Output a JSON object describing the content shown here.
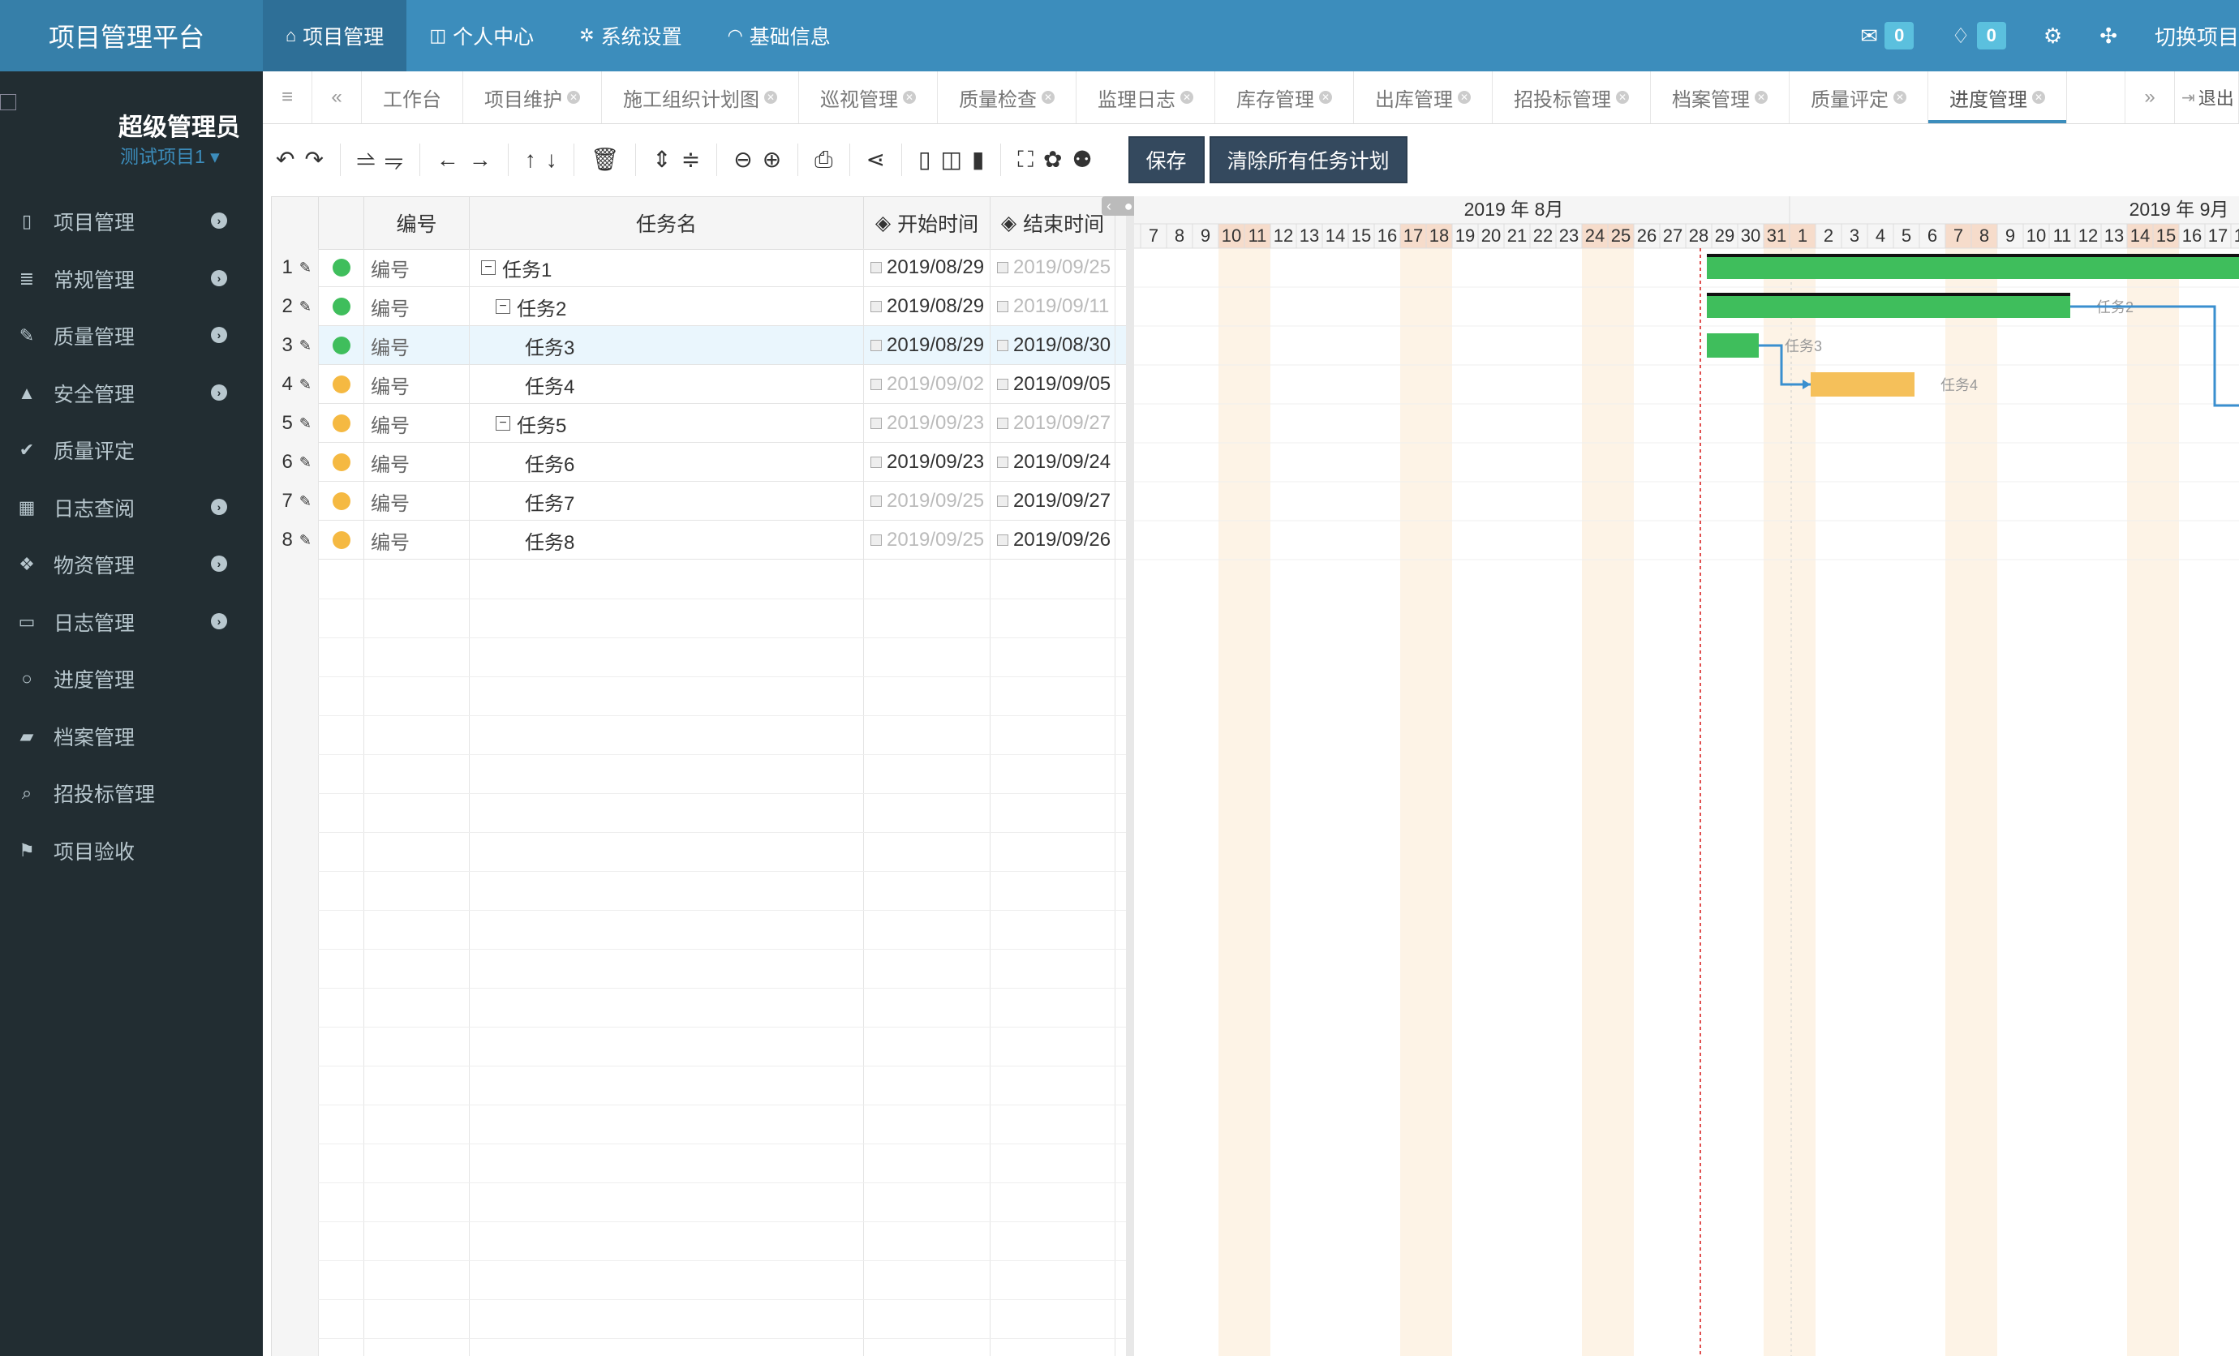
{
  "app_title": "项目管理平台",
  "topnav": [
    {
      "icon": "home-icon",
      "glyph": "⌂",
      "label": "项目管理",
      "active": true
    },
    {
      "icon": "columns-icon",
      "glyph": "◫",
      "label": "个人中心",
      "active": false
    },
    {
      "icon": "gear-icon",
      "glyph": "✲",
      "label": "系统设置",
      "active": false
    },
    {
      "icon": "headset-icon",
      "glyph": "◠",
      "label": "基础信息",
      "active": false
    }
  ],
  "topright": {
    "messages": "0",
    "notifications": "0",
    "switch_label": "切换项目"
  },
  "user": {
    "name": "超级管理员",
    "project": "测试项目1 ▾"
  },
  "sidebar": [
    {
      "icon": "book-icon",
      "glyph": "▯",
      "label": "项目管理",
      "arrow": true
    },
    {
      "icon": "list-icon",
      "glyph": "≣",
      "label": "常规管理",
      "arrow": true
    },
    {
      "icon": "edit-icon",
      "glyph": "✎",
      "label": "质量管理",
      "arrow": true
    },
    {
      "icon": "warning-icon",
      "glyph": "▲",
      "label": "安全管理",
      "arrow": true
    },
    {
      "icon": "check-circle-icon",
      "glyph": "✔",
      "label": "质量评定",
      "arrow": false
    },
    {
      "icon": "calendar-icon",
      "glyph": "▦",
      "label": "日志查阅",
      "arrow": true
    },
    {
      "icon": "cubes-icon",
      "glyph": "❖",
      "label": "物资管理",
      "arrow": true
    },
    {
      "icon": "card-icon",
      "glyph": "▭",
      "label": "日志管理",
      "arrow": true
    },
    {
      "icon": "circle-notch-icon",
      "glyph": "○",
      "label": "进度管理",
      "arrow": false
    },
    {
      "icon": "archive-icon",
      "glyph": "▰",
      "label": "档案管理",
      "arrow": false
    },
    {
      "icon": "search-icon",
      "glyph": "⌕",
      "label": "招投标管理",
      "arrow": false
    },
    {
      "icon": "flag-icon",
      "glyph": "⚑",
      "label": "项目验收",
      "arrow": false
    }
  ],
  "tabs": [
    {
      "label": "工作台",
      "closable": false,
      "active": false
    },
    {
      "label": "项目维护",
      "closable": true,
      "active": false
    },
    {
      "label": "施工组织计划图",
      "closable": true,
      "active": false
    },
    {
      "label": "巡视管理",
      "closable": true,
      "active": false
    },
    {
      "label": "质量检查",
      "closable": true,
      "active": false
    },
    {
      "label": "监理日志",
      "closable": true,
      "active": false
    },
    {
      "label": "库存管理",
      "closable": true,
      "active": false
    },
    {
      "label": "出库管理",
      "closable": true,
      "active": false
    },
    {
      "label": "招投标管理",
      "closable": true,
      "active": false
    },
    {
      "label": "档案管理",
      "closable": true,
      "active": false
    },
    {
      "label": "质量评定",
      "closable": true,
      "active": false
    },
    {
      "label": "进度管理",
      "closable": true,
      "active": true
    }
  ],
  "tabs_logout": "退出",
  "toolbar": {
    "save_label": "保存",
    "clear_label": "清除所有任务计划"
  },
  "grid": {
    "headers": {
      "code": "编号",
      "name": "任务名",
      "start": "开始时间",
      "end": "结束时间"
    },
    "rows": [
      {
        "num": "1",
        "status": "green",
        "code": "编号",
        "name": "任务1",
        "level": 0,
        "expander": true,
        "start": "2019/08/29",
        "start_muted": false,
        "end": "2019/09/25",
        "end_muted": true,
        "selected": false
      },
      {
        "num": "2",
        "status": "green",
        "code": "编号",
        "name": "任务2",
        "level": 1,
        "expander": true,
        "start": "2019/08/29",
        "start_muted": false,
        "end": "2019/09/11",
        "end_muted": true,
        "selected": false
      },
      {
        "num": "3",
        "status": "green",
        "code": "编号",
        "name": "任务3",
        "level": 2,
        "expander": false,
        "start": "2019/08/29",
        "start_muted": false,
        "end": "2019/08/30",
        "end_muted": false,
        "selected": true
      },
      {
        "num": "4",
        "status": "orange",
        "code": "编号",
        "name": "任务4",
        "level": 2,
        "expander": false,
        "start": "2019/09/02",
        "start_muted": true,
        "end": "2019/09/05",
        "end_muted": false,
        "selected": false
      },
      {
        "num": "5",
        "status": "orange",
        "code": "编号",
        "name": "任务5",
        "level": 1,
        "expander": true,
        "start": "2019/09/23",
        "start_muted": true,
        "end": "2019/09/27",
        "end_muted": true,
        "selected": false
      },
      {
        "num": "6",
        "status": "orange",
        "code": "编号",
        "name": "任务6",
        "level": 2,
        "expander": false,
        "start": "2019/09/23",
        "start_muted": false,
        "end": "2019/09/24",
        "end_muted": false,
        "selected": false
      },
      {
        "num": "7",
        "status": "orange",
        "code": "编号",
        "name": "任务7",
        "level": 2,
        "expander": false,
        "start": "2019/09/25",
        "start_muted": true,
        "end": "2019/09/27",
        "end_muted": false,
        "selected": false
      },
      {
        "num": "8",
        "status": "orange",
        "code": "编号",
        "name": "任务8",
        "level": 2,
        "expander": false,
        "start": "2019/09/25",
        "start_muted": true,
        "end": "2019/09/26",
        "end_muted": false,
        "selected": false
      }
    ]
  },
  "gantt": {
    "month_aug": "2019 年 8月",
    "month_sep": "2019 年 9月",
    "first_day": "2019-08-07",
    "day_count": 43,
    "today": "2019-08-29",
    "bars": [
      {
        "row": 0,
        "start": "2019-08-29",
        "end": "2019-09-25",
        "color": "#3fbe5c",
        "type": "summary",
        "label": ""
      },
      {
        "row": 1,
        "start": "2019-08-29",
        "end": "2019-09-11",
        "color": "#3fbe5c",
        "type": "summary",
        "label": "任务2"
      },
      {
        "row": 2,
        "start": "2019-08-29",
        "end": "2019-08-30",
        "color": "#3fbe5c",
        "type": "task",
        "label": "任务3"
      },
      {
        "row": 3,
        "start": "2019-09-02",
        "end": "2019-09-05",
        "color": "#f5c05a",
        "type": "task",
        "label": "任务4"
      }
    ],
    "colors": {
      "weekend": "#fdf3e6",
      "weekend_header": "#f6dccb",
      "today_line": "#e05050",
      "link": "#3a8fcf",
      "green": "#3fbe5c",
      "orange": "#f5b942"
    }
  }
}
